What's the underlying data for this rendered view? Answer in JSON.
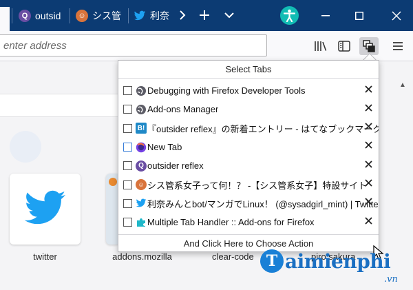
{
  "tabs": [
    {
      "label": "outsid",
      "icon": "outsider-reflex-icon"
    },
    {
      "label": "シス管",
      "icon": "sysadgirl-avatar-icon"
    },
    {
      "label": "利奈",
      "icon": "twitter-bird-icon"
    }
  ],
  "navbar": {
    "url_placeholder": "enter address",
    "url_value": ""
  },
  "toolbar_icons": [
    "library-icon",
    "sidebar-icon",
    "multiple-tab-handler-icon",
    "hamburger-menu-icon"
  ],
  "panel": {
    "title": "Select Tabs",
    "footer": "And Click Here to Choose Action",
    "items": [
      {
        "title": "Debugging with Firefox Developer Tools",
        "icon": "globe-icon",
        "checked": false
      },
      {
        "title": "Add-ons Manager",
        "icon": "globe-icon",
        "checked": false
      },
      {
        "title": "『outsider reflex』の新着エントリー - はてなブックマーク",
        "icon": "hatena-bookmark-icon",
        "checked": false
      },
      {
        "title": "New Tab",
        "icon": "firefox-icon",
        "checked": false
      },
      {
        "title": "outsider reflex",
        "icon": "outsider-reflex-icon",
        "checked": false
      },
      {
        "title": "シス管系女子って何！？ -【シス管系女子】特設サイト",
        "icon": "sysadgirl-avatar-icon",
        "checked": false
      },
      {
        "title": "利奈みんとbot/マンガでLinux！ (@sysadgirl_mint) | Twitter",
        "icon": "twitter-bird-icon",
        "checked": false
      },
      {
        "title": "Multiple Tab Handler :: Add-ons for Firefox",
        "icon": "puzzle-icon",
        "checked": false
      }
    ]
  },
  "tiles": [
    {
      "label": "twitter"
    },
    {
      "label": "addons.mozilla"
    },
    {
      "label": "clear-code"
    },
    {
      "label": "piro.sakura"
    }
  ],
  "watermark": {
    "brand": "aimienphi",
    "initial": "T",
    "suffix": ".vn"
  },
  "colors": {
    "tabstrip": "#0c3b73",
    "account": "#12bcb4",
    "twitter": "#1da1f2",
    "accent": "#3b7fd9"
  }
}
